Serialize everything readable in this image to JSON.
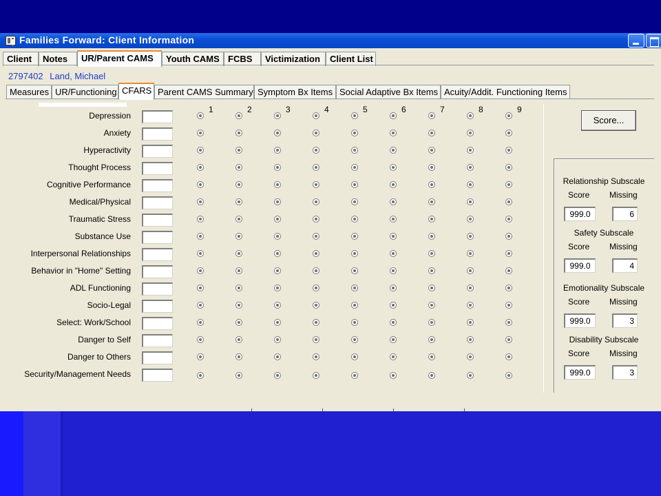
{
  "window": {
    "title": "Families Forward: Client Information"
  },
  "top_tabs": [
    {
      "label": "Client",
      "active": false
    },
    {
      "label": "Notes",
      "active": false
    },
    {
      "label": "UR/Parent CAMS",
      "active": true
    },
    {
      "label": "Youth CAMS",
      "active": false
    },
    {
      "label": "FCBS",
      "active": false
    },
    {
      "label": "Victimization",
      "active": false
    },
    {
      "label": "Client List",
      "active": false
    }
  ],
  "client": {
    "id": "2797402",
    "name": "Land, Michael"
  },
  "sub_tabs": [
    {
      "label": "Measures",
      "active": false
    },
    {
      "label": "UR/Functioning",
      "active": false
    },
    {
      "label": "CFARS",
      "active": true
    },
    {
      "label": "Parent CAMS Summary",
      "active": false
    },
    {
      "label": "Symptom Bx Items",
      "active": false
    },
    {
      "label": "Social Adaptive Bx Items",
      "active": false
    },
    {
      "label": "Acuity/Addit. Functioning Items",
      "active": false
    }
  ],
  "scale_columns": [
    "1",
    "2",
    "3",
    "4",
    "5",
    "6",
    "7",
    "8",
    "9"
  ],
  "rows": [
    {
      "label": "Depression",
      "value": ""
    },
    {
      "label": "Anxiety",
      "value": ""
    },
    {
      "label": "Hyperactivity",
      "value": ""
    },
    {
      "label": "Thought Process",
      "value": ""
    },
    {
      "label": "Cognitive Performance",
      "value": ""
    },
    {
      "label": "Medical/Physical",
      "value": ""
    },
    {
      "label": "Traumatic Stress",
      "value": ""
    },
    {
      "label": "Substance Use",
      "value": ""
    },
    {
      "label": "Interpersonal Relationships",
      "value": ""
    },
    {
      "label": "Behavior in \"Home\" Setting",
      "value": ""
    },
    {
      "label": "ADL Functioning",
      "value": ""
    },
    {
      "label": "Socio-Legal",
      "value": ""
    },
    {
      "label": "Select: Work/School",
      "value": ""
    },
    {
      "label": "Danger to Self",
      "value": ""
    },
    {
      "label": "Danger to Others",
      "value": ""
    },
    {
      "label": "Security/Management Needs",
      "value": ""
    }
  ],
  "score_button": "Score...",
  "subscales": [
    {
      "title": "Relationship Subscale",
      "score_label": "Score",
      "missing_label": "Missing",
      "score": "999.0",
      "missing": "6"
    },
    {
      "title": "Safety Subscale",
      "score_label": "Score",
      "missing_label": "Missing",
      "score": "999.0",
      "missing": "4"
    },
    {
      "title": "Emotionality Subscale",
      "score_label": "Score",
      "missing_label": "Missing",
      "score": "999.0",
      "missing": "3"
    },
    {
      "title": "Disability Subscale",
      "score_label": "Score",
      "missing_label": "Missing",
      "score": "999.0",
      "missing": "3"
    }
  ]
}
